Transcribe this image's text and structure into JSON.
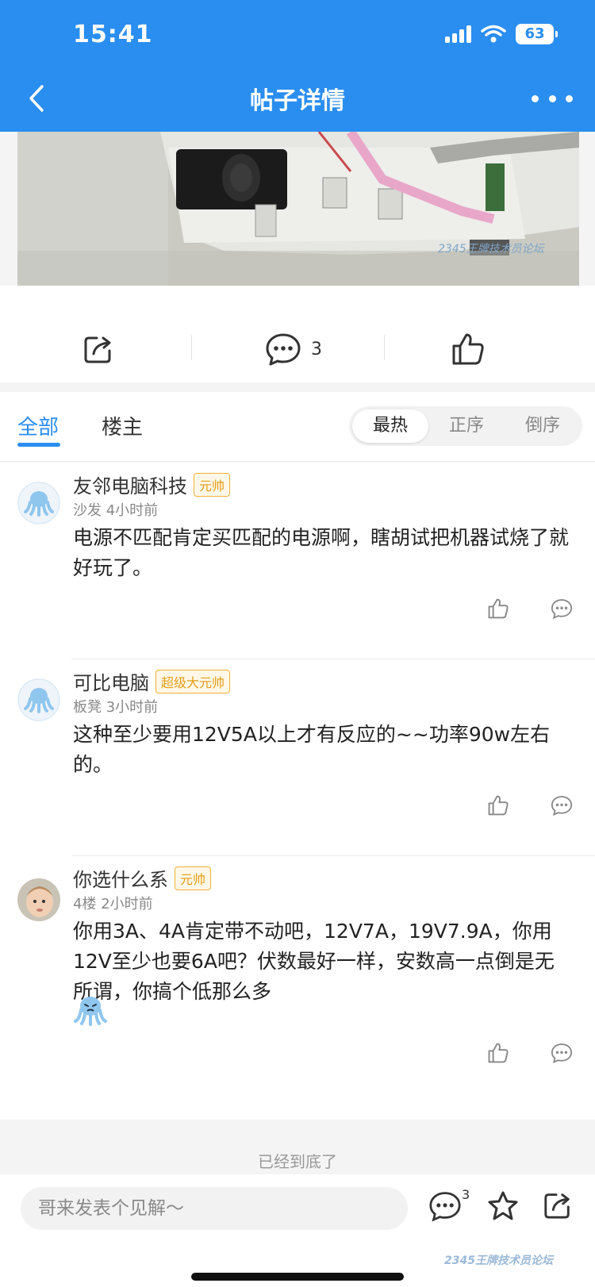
{
  "status": {
    "time": "15:41",
    "battery": "63"
  },
  "nav": {
    "title": "帖子详情"
  },
  "post": {
    "comment_count": "3",
    "image_watermark": "2345王牌技术员论坛"
  },
  "tabs": {
    "all": "全部",
    "op": "楼主"
  },
  "sort": {
    "hot": "最热",
    "asc": "正序",
    "desc": "倒序"
  },
  "comments": [
    {
      "user": "友邻电脑科技",
      "badge": "元帅",
      "floor": "沙发",
      "time": "4小时前",
      "text": "电源不匹配肯定买匹配的电源啊，瞎胡试把机器试烧了就好玩了。"
    },
    {
      "user": "可比电脑",
      "badge": "超级大元帅",
      "floor": "板凳",
      "time": "3小时前",
      "text": "这种至少要用12V5A以上才有反应的~~功率90w左右的。"
    },
    {
      "user": "你选什么系",
      "badge": "元帅",
      "floor": "4楼",
      "time": "2小时前",
      "text": "你用3A、4A肯定带不动吧，12V7A，19V7.9A，你用12V至少也要6A吧？伏数最好一样，安数高一点倒是无所谓，你搞个低那么多"
    }
  ],
  "end_text": "已经到底了",
  "bottom": {
    "placeholder": "哥来发表个见解～",
    "comment_count": "3",
    "watermark": "2345王牌技术员论坛"
  },
  "colors": {
    "brand": "#2a8ef0",
    "badge": "#e49d18"
  }
}
